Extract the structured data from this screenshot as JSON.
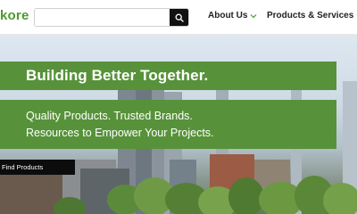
{
  "header": {
    "logo_text": "kore",
    "search": {
      "placeholder": "",
      "value": "",
      "button_icon": "search-icon"
    },
    "nav": [
      {
        "label": "About Us",
        "icon": "chevron-down-icon"
      },
      {
        "label": "Products & Services",
        "icon": "chevron-down-icon"
      }
    ]
  },
  "hero": {
    "headline": "Building Better Together.",
    "subheadline_line1": "Quality Products. Trusted Brands.",
    "subheadline_line2": "Resources to Empower Your Projects.",
    "cta_label": "Find Products"
  },
  "colors": {
    "brand_green": "#57923a",
    "logo_green": "#4d9a2f",
    "dark": "#0c0c0c"
  }
}
